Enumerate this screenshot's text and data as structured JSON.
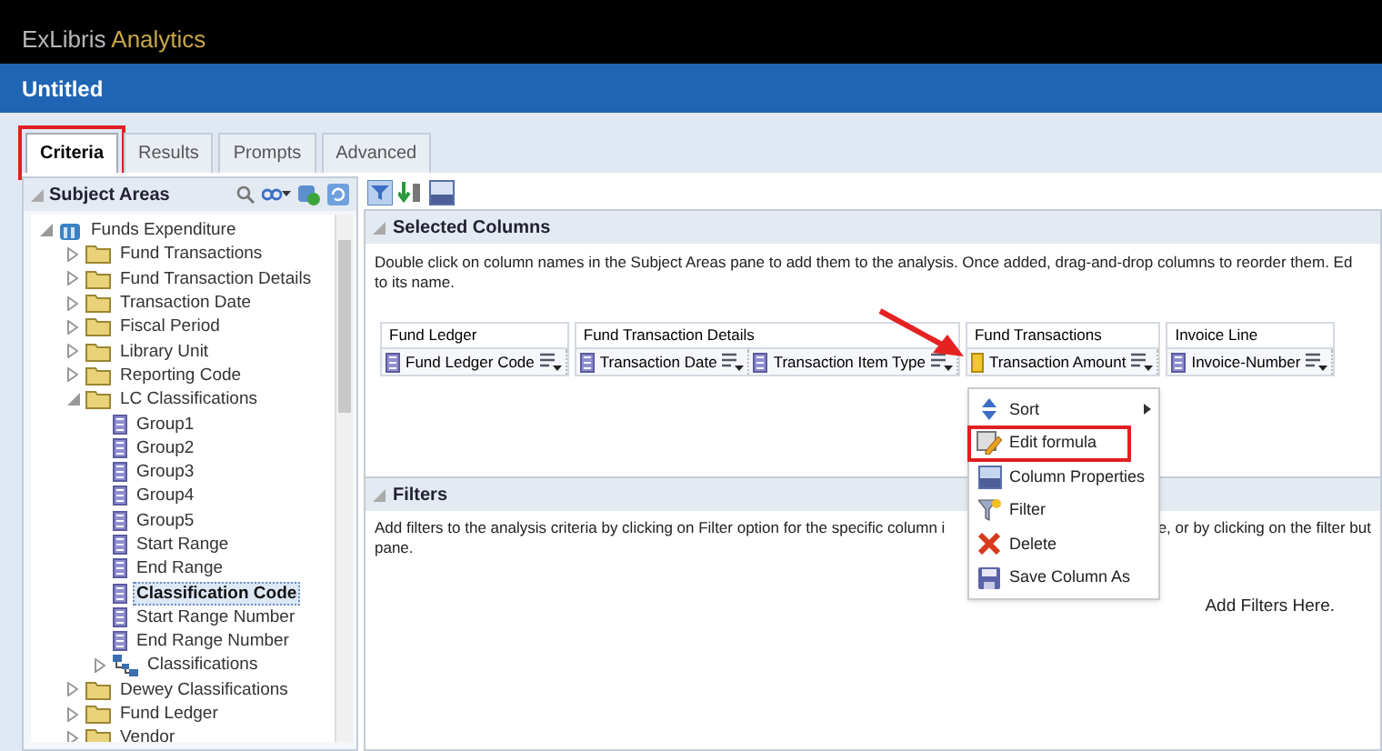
{
  "header": {
    "brand": "ExLibris",
    "product": "Analytics"
  },
  "title_bar": {
    "title": "Untitled"
  },
  "tabs": [
    {
      "label": "Criteria",
      "selected": true,
      "highlighted": true
    },
    {
      "label": "Results",
      "selected": false,
      "highlighted": false
    },
    {
      "label": "Prompts",
      "selected": false,
      "highlighted": false
    },
    {
      "label": "Advanced",
      "selected": false,
      "highlighted": false
    }
  ],
  "subject_areas": {
    "title": "Subject Areas",
    "tree": [
      {
        "label": "Funds Expenditure",
        "kind": "area",
        "expanded": true,
        "selected": false,
        "children": [
          {
            "label": "Fund Transactions",
            "kind": "folder",
            "expanded": false,
            "selected": false
          },
          {
            "label": "Fund Transaction Details",
            "kind": "folder",
            "expanded": false,
            "selected": false
          },
          {
            "label": "Transaction Date",
            "kind": "folder",
            "expanded": false,
            "selected": false
          },
          {
            "label": "Fiscal Period",
            "kind": "folder",
            "expanded": false,
            "selected": false
          },
          {
            "label": "Library Unit",
            "kind": "folder",
            "expanded": false,
            "selected": false
          },
          {
            "label": "Reporting Code",
            "kind": "folder",
            "expanded": false,
            "selected": false
          },
          {
            "label": "LC Classifications",
            "kind": "folder",
            "expanded": true,
            "selected": false,
            "children": [
              {
                "label": "Group1",
                "kind": "column",
                "selected": false
              },
              {
                "label": "Group2",
                "kind": "column",
                "selected": false
              },
              {
                "label": "Group3",
                "kind": "column",
                "selected": false
              },
              {
                "label": "Group4",
                "kind": "column",
                "selected": false
              },
              {
                "label": "Group5",
                "kind": "column",
                "selected": false
              },
              {
                "label": "Start Range",
                "kind": "column",
                "selected": false
              },
              {
                "label": "End Range",
                "kind": "column",
                "selected": false
              },
              {
                "label": "Classification Code",
                "kind": "column",
                "selected": true
              },
              {
                "label": "Start Range Number",
                "kind": "column",
                "selected": false
              },
              {
                "label": "End Range Number",
                "kind": "column",
                "selected": false
              },
              {
                "label": "Classifications",
                "kind": "hierarchy",
                "expanded": false,
                "selected": false
              }
            ]
          },
          {
            "label": "Dewey Classifications",
            "kind": "folder",
            "expanded": false,
            "selected": false
          },
          {
            "label": "Fund Ledger",
            "kind": "folder",
            "expanded": false,
            "selected": false
          },
          {
            "label": "Vendor",
            "kind": "folder",
            "expanded": false,
            "selected": false
          }
        ]
      }
    ]
  },
  "selected_columns": {
    "title": "Selected Columns",
    "description": "Double click on column names in the Subject Areas pane to add them to the analysis. Once added, drag-and-drop columns to reorder them. Ed\nto its name.",
    "groups": [
      {
        "name": "Fund Ledger",
        "columns": [
          {
            "label": "Fund Ledger Code",
            "kind": "attribute"
          }
        ]
      },
      {
        "name": "Fund Transaction Details",
        "columns": [
          {
            "label": "Transaction Date",
            "kind": "attribute"
          },
          {
            "label": "Transaction Item Type",
            "kind": "attribute"
          }
        ]
      },
      {
        "name": "Fund Transactions",
        "columns": [
          {
            "label": "Transaction Amount",
            "kind": "measure"
          }
        ]
      },
      {
        "name": "Invoice Line",
        "columns": [
          {
            "label": "Invoice-Number",
            "kind": "attribute"
          }
        ]
      }
    ]
  },
  "context_menu": {
    "items": [
      {
        "label": "Sort",
        "kind": "sort",
        "submenu": true,
        "highlighted": false
      },
      {
        "label": "Edit formula",
        "kind": "edit",
        "submenu": false,
        "highlighted": true
      },
      {
        "label": "Column Properties",
        "kind": "properties",
        "submenu": false,
        "highlighted": false
      },
      {
        "label": "Filter",
        "kind": "filter",
        "submenu": false,
        "highlighted": false
      },
      {
        "label": "Delete",
        "kind": "delete",
        "submenu": false,
        "highlighted": false
      },
      {
        "label": "Save Column As",
        "kind": "save",
        "submenu": false,
        "highlighted": false
      }
    ]
  },
  "filters": {
    "title": "Filters",
    "description_left": "Add filters to the analysis criteria by clicking on Filter option for the specific column i",
    "description_right": "e, or by clicking on the filter but",
    "description_end": "pane.",
    "empty_text": "Add Filters Here."
  }
}
